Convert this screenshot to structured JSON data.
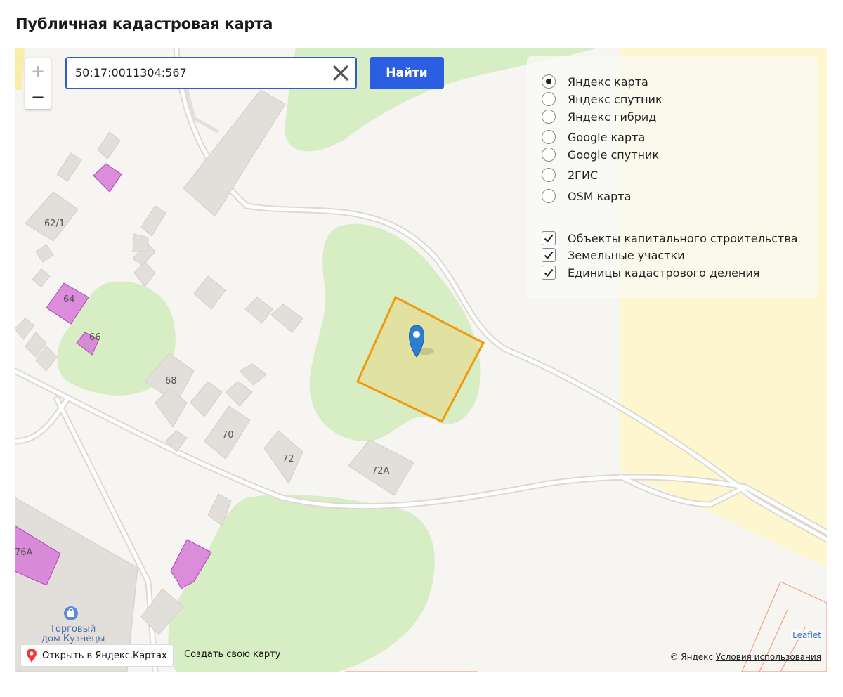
{
  "page": {
    "title": "Публичная кадастровая карта"
  },
  "zoom": {
    "in": "+",
    "out": "−"
  },
  "search": {
    "value": "50:17:0011304:567",
    "button": "Найти"
  },
  "layers": {
    "base_maps": [
      {
        "label": "Яндекс карта",
        "checked": true
      },
      {
        "label": "Яндекс спутник",
        "checked": false
      },
      {
        "label": "Яндекс гибрид",
        "checked": false
      },
      {
        "label": "Google карта",
        "checked": false
      },
      {
        "label": "Google спутник",
        "checked": false
      },
      {
        "label": "2ГИС",
        "checked": false
      },
      {
        "label": "OSM карта",
        "checked": false
      }
    ],
    "overlays": [
      {
        "label": "Объекты капитального строительства",
        "checked": true
      },
      {
        "label": "Земельные участки",
        "checked": true
      },
      {
        "label": "Единицы кадастрового деления",
        "checked": true
      }
    ]
  },
  "map_labels": {
    "b62_1": "62/1",
    "b64": "64",
    "b66": "66",
    "b68": "68",
    "b70": "70",
    "b72": "72",
    "b72a": "72А",
    "b76a": "76А",
    "poi_line1": "Торговый",
    "poi_line2": "дом Кузнецы"
  },
  "footer": {
    "open_yandex": "Открыть в Яндекс.Картах",
    "create_map": "Создать свою карту",
    "leaflet": "Leaflet",
    "copyright": "© Яндекс",
    "terms": "Условия использования"
  },
  "colors": {
    "accent": "#2b5ee0",
    "parcel_outline": "#f09a10",
    "parcel_fill": "#e8d98a",
    "building_purple": "#d67ad8",
    "green": "#d7edc4",
    "yellow_zone": "#fdf6cf",
    "marker": "#2a7fd4"
  }
}
